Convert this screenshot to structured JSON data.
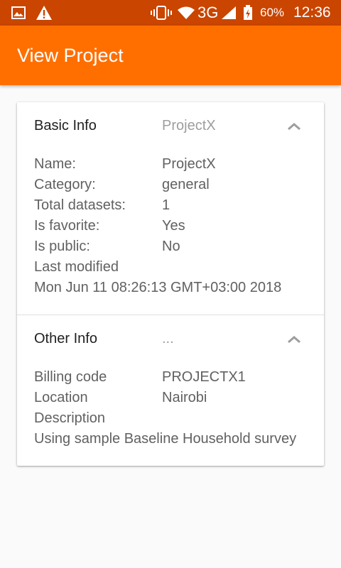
{
  "status_bar": {
    "icons": [
      "image-icon",
      "warning-icon",
      "vibrate-icon",
      "wifi-icon",
      "signal-icon",
      "battery-icon"
    ],
    "network": "3G",
    "battery": "60%",
    "time": "12:36"
  },
  "app_bar": {
    "title": "View Project",
    "color": "#ff6f00"
  },
  "basic_info": {
    "title": "Basic Info",
    "subtitle": "ProjectX",
    "rows": [
      {
        "label": "Name:",
        "value": "ProjectX"
      },
      {
        "label": "Category:",
        "value": "general"
      },
      {
        "label": "Total datasets:",
        "value": "1"
      },
      {
        "label": "Is favorite:",
        "value": "Yes"
      },
      {
        "label": "Is public:",
        "value": "No"
      }
    ],
    "last_modified_label": "Last modified",
    "last_modified_value": "Mon Jun 11 08:26:13 GMT+03:00 2018"
  },
  "other_info": {
    "title": "Other Info",
    "subtitle": "...",
    "rows": [
      {
        "label": "Billing code",
        "value": "PROJECTX1"
      },
      {
        "label": "Location",
        "value": "Nairobi"
      }
    ],
    "description_label": "Description",
    "description_value": "Using sample Baseline Household survey"
  }
}
